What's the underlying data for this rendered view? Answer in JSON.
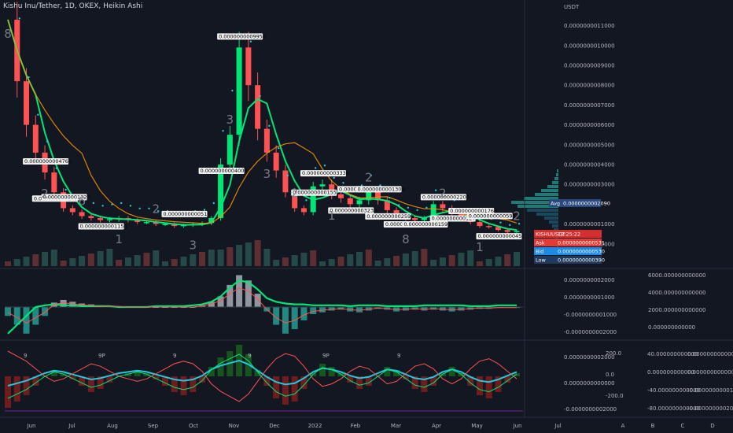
{
  "header": {
    "title": "Kishu Inu/Tether, 1D, OKEX, Heikin Ashi"
  },
  "colors": {
    "bg": "#131722",
    "up": "#00e676",
    "down": "#ff5252",
    "cyan": "#26c6da",
    "orange": "#ff9800",
    "grid": "#1e222d",
    "axis": "#2a2e39"
  },
  "chart_data": [
    {
      "type": "line",
      "name": "main-price",
      "ylabel": "USDT",
      "x_ticks": [
        "Jun",
        "Jul",
        "Aug",
        "Sep",
        "Oct",
        "Nov",
        "Dec",
        "2022",
        "Feb",
        "Mar",
        "Apr",
        "May",
        "Jun",
        "Jul"
      ],
      "price_ticks": [
        "0.0000000011000",
        "0.0000000010000",
        "0.0000000009000",
        "0.0000000008000",
        "0.0000000007000",
        "0.0000000006000",
        "0.0000000005000",
        "0.0000000004000",
        "0.0000000003000",
        "0.0000000001000",
        "0.0000000000000"
      ],
      "price_tick_values": [
        11,
        10,
        9,
        8,
        7,
        6,
        5,
        4,
        3,
        1,
        0
      ],
      "ylim": [
        -1.2,
        11.5
      ],
      "close": [
        11.3,
        8.2,
        6.0,
        4.6,
        3.6,
        2.6,
        1.8,
        1.6,
        1.4,
        1.3,
        1.2,
        1.25,
        1.3,
        1.2,
        1.1,
        1.1,
        1.0,
        1.0,
        0.9,
        0.95,
        1.0,
        1.05,
        1.3,
        4.0,
        5.5,
        9.9,
        8.0,
        5.8,
        4.6,
        3.7,
        2.6,
        1.8,
        1.6,
        2.9,
        3.0,
        2.5,
        2.3,
        2.0,
        2.2,
        2.6,
        2.2,
        1.7,
        1.4,
        1.3,
        1.2,
        1.3,
        2.0,
        1.8,
        1.6,
        1.25,
        1.1,
        0.9,
        0.85,
        0.7,
        0.6,
        0.65
      ],
      "markers": [
        {
          "text": "0.0000000004760",
          "i": 4
        },
        {
          "text": "0.0000000001450",
          "i": 5
        },
        {
          "text": "0.0000000001320",
          "i": 6
        },
        {
          "text": "0.0000000001150",
          "i": 10
        },
        {
          "text": "0.0000000000510",
          "i": 19
        },
        {
          "text": "0.0000000004000",
          "i": 23
        },
        {
          "text": "0.0000000009950",
          "i": 25
        },
        {
          "text": "0.0000000001555",
          "i": 33
        },
        {
          "text": "0.0000000003330",
          "i": 34
        },
        {
          "text": "0.0000000003230",
          "i": 37
        },
        {
          "text": "0.0000000001884",
          "i": 38
        },
        {
          "text": "0.0000000002599",
          "i": 41
        },
        {
          "text": "0.0000000001309",
          "i": 40
        },
        {
          "text": "0.0000000001105",
          "i": 43
        },
        {
          "text": "0.0000000002200",
          "i": 47
        },
        {
          "text": "0.0000000001592",
          "i": 45
        },
        {
          "text": "0.0000000001760",
          "i": 50
        },
        {
          "text": "0.0000000001275",
          "i": 48
        },
        {
          "text": "0.0000000000598",
          "i": 52
        },
        {
          "text": "0.0000000000450",
          "i": 53
        }
      ],
      "wave_labels": [
        "8",
        "2",
        "6",
        "1",
        "2",
        "3",
        "3",
        "3",
        "2",
        "1",
        "2",
        "8",
        "2",
        "1",
        "2"
      ],
      "price_tags": [
        {
          "label": "Avg",
          "value": "0.0000000002090"
        },
        {
          "label": "KISHUUSDT",
          "value": "12:25:22"
        },
        {
          "label": "Ask",
          "value": "0.0000000000531"
        },
        {
          "label": "Bid",
          "value": "0.0000000000530"
        },
        {
          "label": "Low",
          "value": "0.0000000000390"
        }
      ]
    },
    {
      "type": "area",
      "name": "macd-panel",
      "left_ticks": [
        "0.0000000002000",
        "0.0000000001000",
        "-0.0000000001000",
        "-0.0000000002000"
      ],
      "right_ticks": [
        "6000.000000000000",
        "4000.000000000000",
        "2000.000000000000",
        "0.000000000000"
      ],
      "histogram": [
        -1,
        -2,
        -3,
        -2,
        -1,
        0.5,
        0.8,
        0.6,
        0.4,
        0.3,
        0.2,
        0.1,
        0.1,
        0,
        0,
        0,
        0,
        0,
        0,
        0,
        0,
        0.2,
        0.6,
        1.2,
        2.5,
        3.6,
        3.0,
        1.5,
        -0.5,
        -2.0,
        -3.0,
        -2.5,
        -1.5,
        -0.8,
        -0.6,
        -0.4,
        -0.3,
        -0.5,
        -0.6,
        -0.4,
        -0.2,
        -0.3,
        -0.5,
        -0.4,
        -0.3,
        -0.4,
        -0.3,
        -0.4,
        -0.5,
        -0.4,
        -0.3,
        -0.2,
        -0.2,
        -0.1,
        -0.1,
        -0.1
      ],
      "signal": [
        -3,
        -2,
        -1,
        0,
        0.2,
        0.3,
        0.2,
        0.2,
        0.1,
        0.1,
        0.1,
        0.1,
        0,
        0,
        0,
        0,
        0.1,
        0.1,
        0.1,
        0.1,
        0.2,
        0.3,
        0.6,
        1.2,
        2.2,
        3.0,
        2.8,
        2.0,
        1.0,
        0.6,
        0.4,
        0.3,
        0.3,
        0.2,
        0.2,
        0.2,
        0.2,
        0.1,
        0.2,
        0.2,
        0.2,
        0.1,
        0.1,
        0.1,
        0.1,
        0.2,
        0.2,
        0.2,
        0.2,
        0.2,
        0.1,
        0.1,
        0.1,
        0.2,
        0.2,
        0.2
      ]
    },
    {
      "type": "area",
      "name": "oscillator-panel",
      "left_ticks": [
        "0.0000000002000",
        "0.0000000000000",
        "-0.0000000002000"
      ],
      "mid_ticks": [
        "200.0",
        "0.0",
        "-200.0"
      ],
      "right_ticks": [
        "40.000000000000",
        "0.000000000000",
        "-40.000000000000",
        "-80.000000000000"
      ],
      "far_ticks": [
        "0.000000000000",
        "0.000000000000",
        "-0.00000000001",
        "-0.0000000002000"
      ],
      "wave": [
        -1,
        -0.8,
        -0.6,
        -0.3,
        0,
        0.2,
        0.1,
        -0.1,
        -0.3,
        -0.5,
        -0.4,
        -0.2,
        0,
        0.1,
        0.2,
        0.1,
        -0.1,
        -0.3,
        -0.5,
        -0.6,
        -0.5,
        -0.2,
        0.3,
        0.6,
        0.8,
        1.0,
        0.7,
        0.2,
        -0.3,
        -0.7,
        -0.9,
        -0.8,
        -0.4,
        0.1,
        0.4,
        0.3,
        0.1,
        -0.2,
        -0.4,
        -0.3,
        0,
        0.3,
        0.2,
        -0.1,
        -0.4,
        -0.5,
        -0.3,
        0.1,
        0.3,
        0.1,
        -0.3,
        -0.6,
        -0.7,
        -0.5,
        -0.2,
        0.1
      ],
      "ticks_labels": [
        "9",
        "9P",
        "9",
        "9",
        "9P",
        "9"
      ]
    }
  ],
  "watermarks": [
    "A",
    "B",
    "C",
    "D"
  ]
}
